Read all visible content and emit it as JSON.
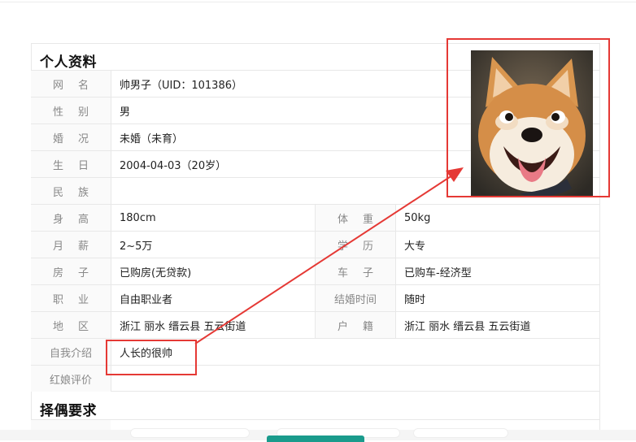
{
  "profile": {
    "section_title": "个人资料",
    "rows": [
      {
        "label": "网名",
        "value": "帅男子（UID：101386）"
      },
      {
        "label": "性别",
        "value": "男"
      },
      {
        "label": "婚况",
        "value": "未婚（未育）"
      },
      {
        "label": "生日",
        "value": "2004-04-03（20岁）"
      },
      {
        "label": "民族",
        "value": ""
      },
      {
        "label": "身高",
        "value": "180cm",
        "label2": "体重",
        "value2": "50kg"
      },
      {
        "label": "月薪",
        "value": "2~5万",
        "label2": "学历",
        "value2": "大专"
      },
      {
        "label": "房子",
        "value": "已购房(无贷款)",
        "label2": "车子",
        "value2": "已购车-经济型"
      },
      {
        "label": "职业",
        "value": "自由职业者",
        "label2": "结婚时间",
        "value2": "随时"
      },
      {
        "label": "地区",
        "value": "浙江 丽水 缙云县 五云街道",
        "label2": "户籍",
        "value2": "浙江 丽水 缙云县 五云街道"
      },
      {
        "label": "自我介绍",
        "value": "人长的很帅"
      },
      {
        "label": "红娘评价",
        "value": ""
      }
    ]
  },
  "partner": {
    "section_title": "择偶要求"
  },
  "colors": {
    "annotation": "#e53935",
    "accent": "#1a9b8c"
  }
}
